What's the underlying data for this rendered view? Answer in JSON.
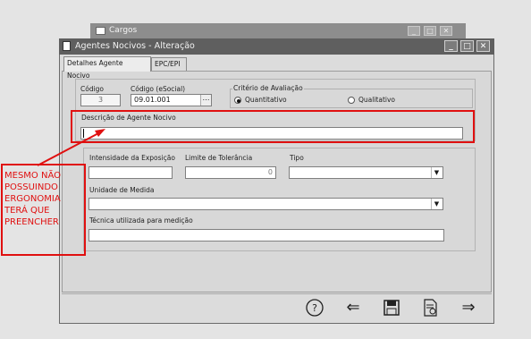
{
  "background_window": {
    "title": "Cargos"
  },
  "window": {
    "title": "Agentes Nocivos - Alteração"
  },
  "tabs": [
    {
      "label": "Detalhes Agente Nocivo",
      "active": true
    },
    {
      "label": "EPC/EPI",
      "active": false
    }
  ],
  "fields": {
    "codigo": {
      "label": "Código",
      "value": "3"
    },
    "codigo_esocial": {
      "label": "Código (eSocial)",
      "value": "09.01.001"
    },
    "criterio": {
      "legend": "Critério de Avaliação",
      "options": [
        {
          "label": "Quantitativo",
          "selected": true
        },
        {
          "label": "Qualitativo",
          "selected": false
        }
      ]
    },
    "descricao": {
      "label": "Descrição de Agente Nocivo",
      "value": ""
    },
    "intensidade": {
      "label": "Intensidade da Exposição",
      "value": ""
    },
    "limite": {
      "label": "Limite de Tolerância",
      "value": "0"
    },
    "tipo": {
      "label": "Tipo",
      "value": ""
    },
    "unidade": {
      "label": "Unidade de Medida",
      "value": ""
    },
    "tecnica": {
      "label": "Técnica utilizada para medição",
      "value": ""
    }
  },
  "annotation": {
    "lines": [
      "MESMO NÃO",
      "POSSUINDO",
      "ERGONOMIA",
      "TERÁ QUE",
      "PREENCHER"
    ],
    "color": "#e01010"
  },
  "toolbar": {
    "help": "?",
    "back": "⇐",
    "save": "save-icon",
    "report": "report-icon",
    "forward": "⇒"
  }
}
